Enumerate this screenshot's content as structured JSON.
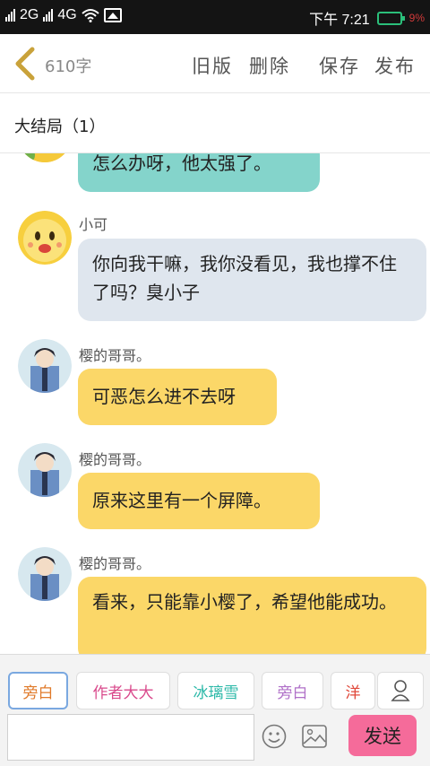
{
  "status_bar": {
    "network1": "2G",
    "network2": "4G",
    "time": "下午 7:21",
    "battery_pct": "9%"
  },
  "header": {
    "word_count": "610字",
    "buttons": [
      "旧版",
      "删除",
      "保存",
      "发布"
    ]
  },
  "chapter": {
    "title": "大结局（1）"
  },
  "messages": [
    {
      "speaker": "",
      "text": "怎么办呀，他太强了。",
      "bubble_color": "#84d4cb"
    },
    {
      "speaker": "小可",
      "text": "你向我干嘛，我你没看见，我也撑不住了吗？臭小子",
      "bubble_color": "#dfe6ee"
    },
    {
      "speaker": "樱的哥哥。",
      "text": "可恶怎么进不去呀",
      "bubble_color": "#fbd768"
    },
    {
      "speaker": "樱的哥哥。",
      "text": "原来这里有一个屏障。",
      "bubble_color": "#fbd768"
    },
    {
      "speaker": "樱的哥哥。",
      "text": "看来，只能靠小樱了，希望他能成功。",
      "bubble_color": "#fbd768"
    }
  ],
  "roles": [
    {
      "label": "旁白",
      "color": "#e07a2a"
    },
    {
      "label": "作者大大",
      "color": "#d94a8c"
    },
    {
      "label": "冰璃雪",
      "color": "#2bb8a8"
    },
    {
      "label": "旁白",
      "color": "#b070c8"
    },
    {
      "label": "洋",
      "color": "#e0483a"
    }
  ],
  "input": {
    "placeholder": ""
  },
  "send_label": "发送"
}
